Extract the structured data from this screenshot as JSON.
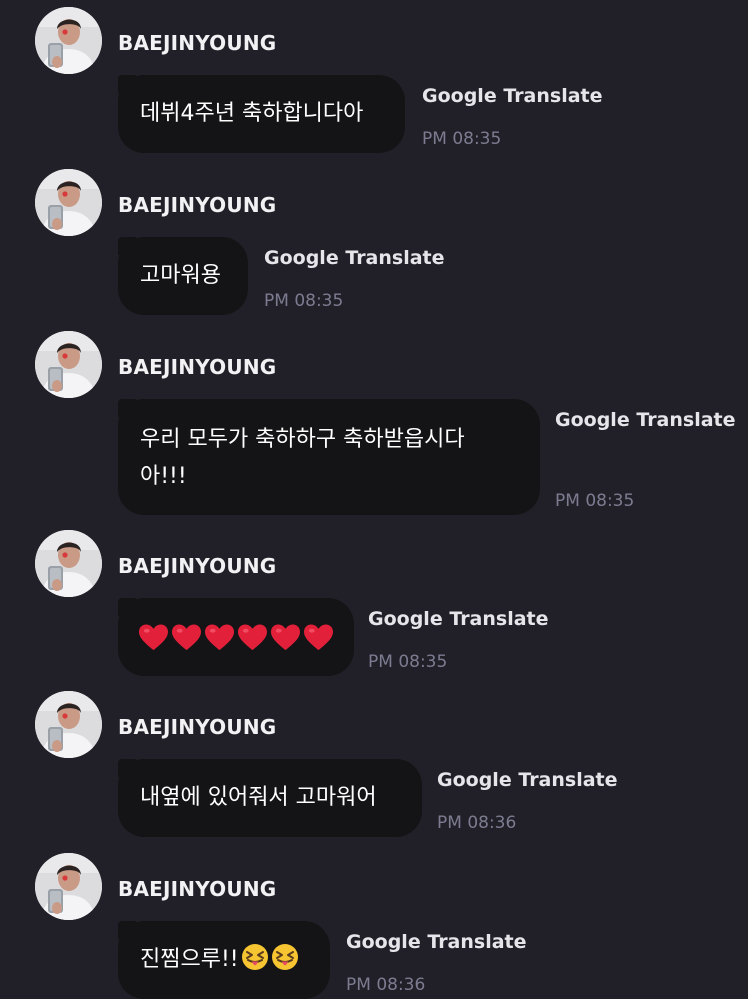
{
  "colors": {
    "background": "#212028",
    "bubble": "#141416",
    "sender_text": "#f2f2f4",
    "time_text": "#7d7b90",
    "heart": "#e2203a"
  },
  "messages": [
    {
      "sender": "BAEJINYOUNG",
      "text": "데뷔4주년 축하합니다아",
      "translate_label": "Google Translate",
      "time": "PM 08:35"
    },
    {
      "sender": "BAEJINYOUNG",
      "text": "고마워용",
      "translate_label": "Google Translate",
      "time": "PM 08:35"
    },
    {
      "sender": "BAEJINYOUNG",
      "text_line1": "우리 모두가 축하하구 축하받읍시다",
      "text_line2": "아!!!",
      "translate_label": "Google Translate",
      "time": "PM 08:35"
    },
    {
      "sender": "BAEJINYOUNG",
      "hearts": 6,
      "hearts_emoji": "❤️",
      "translate_label": "Google Translate",
      "time": "PM 08:35"
    },
    {
      "sender": "BAEJINYOUNG",
      "text": "내옆에 있어줘서 고마워어",
      "translate_label": "Google Translate",
      "time": "PM 08:36"
    },
    {
      "sender": "BAEJINYOUNG",
      "text": "진찜으루!!",
      "emoji": "😝😝",
      "translate_label": "Google Translate",
      "time": "PM 08:36"
    }
  ]
}
